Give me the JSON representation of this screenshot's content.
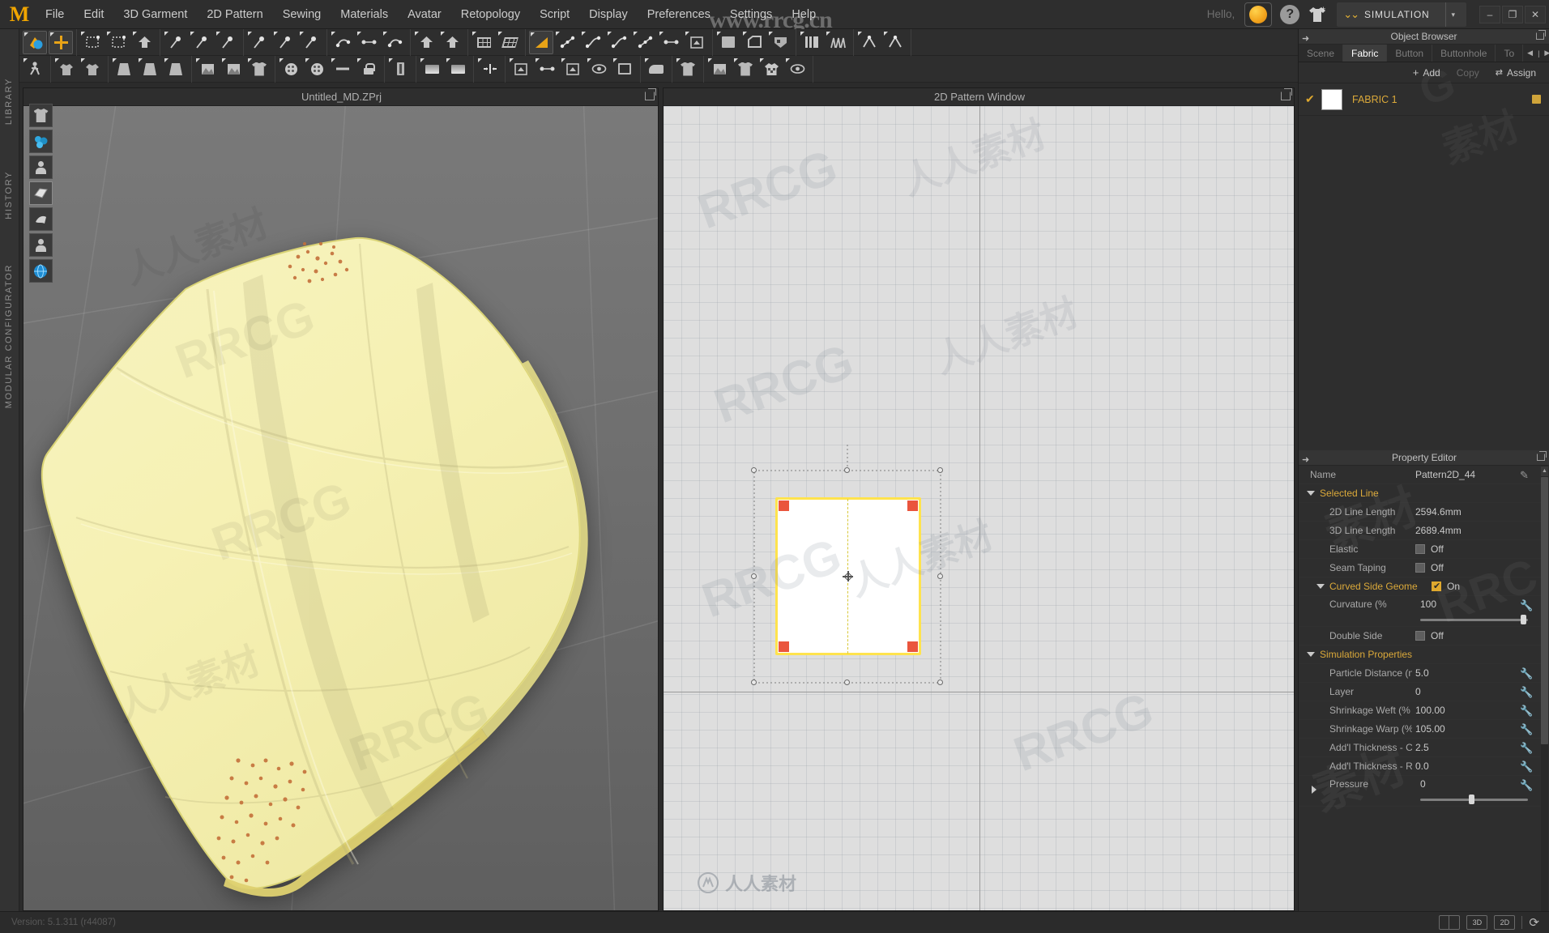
{
  "app": {
    "logo": "M",
    "version_label": "Version: 5.1.311 (r44087)"
  },
  "menubar": {
    "items": [
      "File",
      "Edit",
      "3D Garment",
      "2D Pattern",
      "Sewing",
      "Materials",
      "Avatar",
      "Retopology",
      "Script",
      "Display",
      "Preferences",
      "Settings",
      "Help"
    ],
    "hello": "Hello,",
    "help_glyph": "?",
    "mode_label": "SIMULATION",
    "mode_chevron": "chevron-double-down-icon",
    "mode_dropdown_arrow": "▾",
    "window_controls": [
      "–",
      "❐",
      "✕"
    ],
    "accent_orange": "#e8a317"
  },
  "leftbar": {
    "items": [
      "LIBRARY",
      "HISTORY",
      "MODULAR CONFIGURATOR"
    ]
  },
  "viewport_3d": {
    "title": "Untitled_MD.ZPrj",
    "popout_icon": "popout-icon",
    "side_icons": [
      "garment-icon",
      "simulation-particles-icon",
      "avatar-icon",
      "fabric-fold-icon",
      "cloth-drape-icon",
      "avatar-head-icon",
      "globe-icon"
    ]
  },
  "viewport_2d": {
    "title": "2D Pattern Window",
    "popout_icon": "popout-icon",
    "pattern_name": "Pattern2D_44"
  },
  "toolbar_row1": {
    "groups": [
      {
        "tools": [
          {
            "name": "simulate-tool",
            "icon": "simulate-icon",
            "active": true
          },
          {
            "name": "transform-tool",
            "icon": "move-gizmo-icon",
            "active": true
          }
        ]
      },
      {
        "tools": [
          {
            "name": "select-mesh-tool",
            "icon": "select-mesh-icon",
            "active": false
          },
          {
            "name": "box-select-tool",
            "icon": "box-select-icon",
            "active": false
          },
          {
            "name": "fold-arrange-tool",
            "icon": "fold-arrange-icon",
            "active": false
          }
        ]
      },
      {
        "tools": [
          {
            "name": "pin-tool",
            "icon": "pin-icon",
            "active": false
          },
          {
            "name": "seam-pin-tool",
            "icon": "seam-pin-icon",
            "active": false
          },
          {
            "name": "curve-pin-tool",
            "icon": "curve-pin-icon",
            "active": false
          }
        ]
      },
      {
        "tools": [
          {
            "name": "tack-tool",
            "icon": "tack-icon",
            "active": false
          },
          {
            "name": "tack-pattern-tool",
            "icon": "tack-pattern-icon",
            "active": false
          },
          {
            "name": "tack-garment-tool",
            "icon": "tack-garment-icon",
            "active": false
          }
        ]
      },
      {
        "tools": [
          {
            "name": "sew-free-tool",
            "icon": "sew-free-icon",
            "active": false
          },
          {
            "name": "sew-segment-tool",
            "icon": "sew-segment-icon",
            "active": false
          },
          {
            "name": "sew-garment-tool",
            "icon": "sew-garment-icon",
            "active": false
          }
        ]
      },
      {
        "tools": [
          {
            "name": "fold-arrangement-tool",
            "icon": "fold-arrangement-icon",
            "active": false
          },
          {
            "name": "arrange-avatar-tool",
            "icon": "arrange-avatar-icon",
            "active": false
          }
        ]
      },
      {
        "tools": [
          {
            "name": "mesh-grid-tool",
            "icon": "mesh-grid-icon",
            "active": false
          },
          {
            "name": "mesh-grid-skew-tool",
            "icon": "mesh-grid-skew-icon",
            "active": false
          }
        ]
      },
      {
        "tools": [
          {
            "name": "polygon-tool",
            "icon": "polygon-triangle-icon",
            "active": true
          },
          {
            "name": "edit-point-tool",
            "icon": "edit-point-icon",
            "active": false
          },
          {
            "name": "curve-point-tool",
            "icon": "curve-point-icon",
            "active": false
          },
          {
            "name": "edit-curvature-tool",
            "icon": "edit-curvature-icon",
            "active": false
          },
          {
            "name": "add-point-tool",
            "icon": "add-point-icon",
            "active": false
          },
          {
            "name": "segment-tool",
            "icon": "segment-icon",
            "active": false
          },
          {
            "name": "fold-pattern-tool",
            "icon": "fold-pattern-icon",
            "active": false
          }
        ]
      },
      {
        "tools": [
          {
            "name": "rectangle-tool",
            "icon": "rectangle-icon",
            "active": false
          },
          {
            "name": "polygon-shape-tool",
            "icon": "polygon-shape-icon",
            "active": false
          },
          {
            "name": "internal-shape-tool",
            "icon": "internal-shape-icon",
            "active": false
          }
        ]
      },
      {
        "tools": [
          {
            "name": "pleat-tool",
            "icon": "pleat-icon",
            "active": false
          },
          {
            "name": "pleat-fold-tool",
            "icon": "pleat-fold-icon",
            "active": false
          }
        ]
      },
      {
        "tools": [
          {
            "name": "trace-tool",
            "icon": "trace-icon",
            "active": false
          },
          {
            "name": "dart-tool",
            "icon": "dart-icon",
            "active": false
          }
        ]
      }
    ]
  },
  "toolbar_row2": {
    "groups": [
      {
        "tools": [
          {
            "name": "avatar-walk-tool",
            "icon": "avatar-walk-icon"
          }
        ]
      },
      {
        "tools": [
          {
            "name": "avatar-pose-tool",
            "icon": "avatar-pose-icon"
          },
          {
            "name": "avatar-gizmo-tool",
            "icon": "avatar-gizmo-icon"
          }
        ]
      },
      {
        "tools": [
          {
            "name": "skirt-tool",
            "icon": "skirt-icon"
          },
          {
            "name": "skirt-flare-tool",
            "icon": "skirt-flare-icon"
          },
          {
            "name": "garment-fold-tool",
            "icon": "garment-fold-icon"
          }
        ]
      },
      {
        "tools": [
          {
            "name": "texture-tool",
            "icon": "texture-icon"
          },
          {
            "name": "pattern-texture-tool",
            "icon": "pattern-texture-icon"
          },
          {
            "name": "garment-texture-tool",
            "icon": "garment-texture-icon"
          }
        ]
      },
      {
        "tools": [
          {
            "name": "button-tool",
            "icon": "button-icon"
          },
          {
            "name": "buttonhole-tool",
            "icon": "buttonhole-icon"
          },
          {
            "name": "snap-line-tool",
            "icon": "snap-line-icon"
          },
          {
            "name": "lock-button-tool",
            "icon": "lock-button-icon"
          }
        ]
      },
      {
        "tools": [
          {
            "name": "zipper-tool",
            "icon": "zipper-icon"
          }
        ]
      },
      {
        "tools": [
          {
            "name": "gradient-tool",
            "icon": "gradient-icon"
          },
          {
            "name": "gradient-flat-tool",
            "icon": "gradient-flat-icon"
          }
        ]
      },
      {
        "tools": [
          {
            "name": "symmetry-tool",
            "icon": "symmetry-icon"
          }
        ]
      },
      {
        "tools": [
          {
            "name": "flatten-tool",
            "icon": "flatten-icon"
          },
          {
            "name": "seam-line-tool",
            "icon": "seam-line-icon"
          },
          {
            "name": "turn-tool",
            "icon": "turn-icon"
          },
          {
            "name": "eye-pattern-tool",
            "icon": "eye-pattern-icon"
          },
          {
            "name": "zoom-pattern-tool",
            "icon": "zoom-pattern-icon"
          }
        ]
      },
      {
        "tools": [
          {
            "name": "iron-tool",
            "icon": "iron-icon"
          }
        ]
      },
      {
        "tools": [
          {
            "name": "garment-preview-tool",
            "icon": "garment-preview-icon"
          }
        ]
      },
      {
        "tools": [
          {
            "name": "texture-map-tool",
            "icon": "texture-map-icon"
          },
          {
            "name": "texture-shirt-tool",
            "icon": "texture-shirt-icon"
          },
          {
            "name": "checker-shirt-tool",
            "icon": "checker-shirt-icon"
          },
          {
            "name": "eye-gizmo-tool",
            "icon": "eye-gizmo-icon"
          }
        ]
      }
    ]
  },
  "object_browser": {
    "title": "Object Browser",
    "tabs": [
      {
        "label": "Scene",
        "active": false
      },
      {
        "label": "Fabric",
        "active": true
      },
      {
        "label": "Button",
        "active": false
      },
      {
        "label": "Buttonhole",
        "active": false
      },
      {
        "label": "To",
        "active": false
      }
    ],
    "nav_prev": "◀",
    "nav_sep": "|",
    "nav_next": "▶",
    "actions": [
      {
        "label": "Add",
        "icon": "plus-icon",
        "enabled": true
      },
      {
        "label": "Copy",
        "icon": "copy-icon",
        "enabled": false
      },
      {
        "label": "Assign",
        "icon": "assign-icon",
        "enabled": true
      }
    ],
    "items": [
      {
        "checked": "✔",
        "name": "FABRIC 1",
        "swatch_color": "#ffffff",
        "save_icon": "save-icon"
      }
    ]
  },
  "property_editor": {
    "title": "Property Editor",
    "name_label": "Name",
    "name_value": "Pattern2D_44",
    "edit_icon": "pencil-icon",
    "sections": [
      {
        "label": "Selected Line",
        "expanded": true,
        "rows": [
          {
            "label": "2D Line Length",
            "value": "2594.6mm",
            "type": "text"
          },
          {
            "label": "3D Line Length",
            "value": "2689.4mm",
            "type": "text"
          },
          {
            "label": "Elastic",
            "value": "Off",
            "type": "checkbox",
            "checked": false
          },
          {
            "label": "Seam Taping",
            "value": "Off",
            "type": "checkbox",
            "checked": false
          }
        ]
      },
      {
        "label": "Curved Side Geome",
        "expanded": true,
        "is_subgroup": true,
        "value": "On",
        "checked": true,
        "rows": [
          {
            "label": "Curvature (%",
            "value": "100",
            "type": "slider",
            "slider_pct": 96,
            "wrench": true
          },
          {
            "label": "Double Side",
            "value": "Off",
            "type": "checkbox",
            "checked": false
          }
        ]
      },
      {
        "label": "Simulation Properties",
        "expanded": true,
        "rows": [
          {
            "label": "Particle Distance (n",
            "value": "5.0",
            "type": "text",
            "wrench": true
          },
          {
            "label": "Layer",
            "value": "0",
            "type": "text",
            "wrench": true
          },
          {
            "label": "Shrinkage Weft (%",
            "value": "100.00",
            "type": "text",
            "wrench": true
          },
          {
            "label": "Shrinkage Warp (%",
            "value": "105.00",
            "type": "text",
            "wrench": true
          },
          {
            "label": "Add'l Thickness - Collisi",
            "value": "2.5",
            "type": "text",
            "wrench": true
          },
          {
            "label": "Add'l Thickness - Rend",
            "value": "0.0",
            "type": "text",
            "wrench": true
          },
          {
            "label": "Pressure",
            "value": "0",
            "type": "slider",
            "slider_pct": 48,
            "wrench": true,
            "collapsed": true
          }
        ]
      }
    ]
  },
  "statusbar": {
    "view_split_icon": "split-view-icon",
    "buttons": [
      "3D",
      "2D"
    ],
    "reset_icon": "reset-icon"
  },
  "watermarks": {
    "url": "www.rrcg.cn",
    "rrcg": "RRCG",
    "cn": "人人素材"
  }
}
